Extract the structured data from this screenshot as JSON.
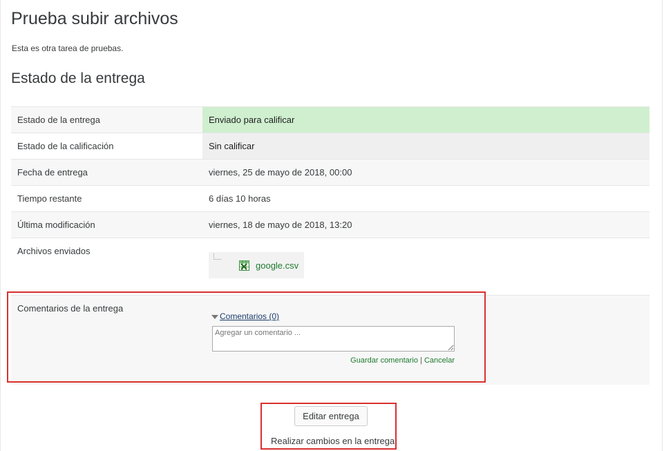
{
  "page": {
    "title": "Prueba subir archivos",
    "intro": "Esta es otra tarea de pruebas.",
    "section_title": "Estado de la entrega"
  },
  "status": {
    "rows": [
      {
        "label": "Estado de la entrega",
        "value": "Enviado para calificar"
      },
      {
        "label": "Estado de la calificación",
        "value": "Sin calificar"
      },
      {
        "label": "Fecha de entrega",
        "value": "viernes, 25 de mayo de 2018, 00:00"
      },
      {
        "label": "Tiempo restante",
        "value": "6 días 10 horas"
      },
      {
        "label": "Última modificación",
        "value": "viernes, 18 de mayo de 2018, 13:20"
      }
    ],
    "files_label": "Archivos enviados",
    "file_name": "google.csv",
    "file_icon": "spreadsheet-icon",
    "comments_label": "Comentarios de la entrega",
    "comments_toggle": "Comentarios (0)",
    "comment_placeholder": "Agregar un comentario ...",
    "save_comment": "Guardar comentario",
    "separator": "|",
    "cancel": "Cancelar"
  },
  "actions": {
    "edit_button": "Editar entrega",
    "edit_description": "Realizar cambios en la entrega"
  },
  "colors": {
    "submitted_bg": "#cfefcf",
    "highlight_border": "#d9302f",
    "link_green": "#1e7a2e"
  }
}
